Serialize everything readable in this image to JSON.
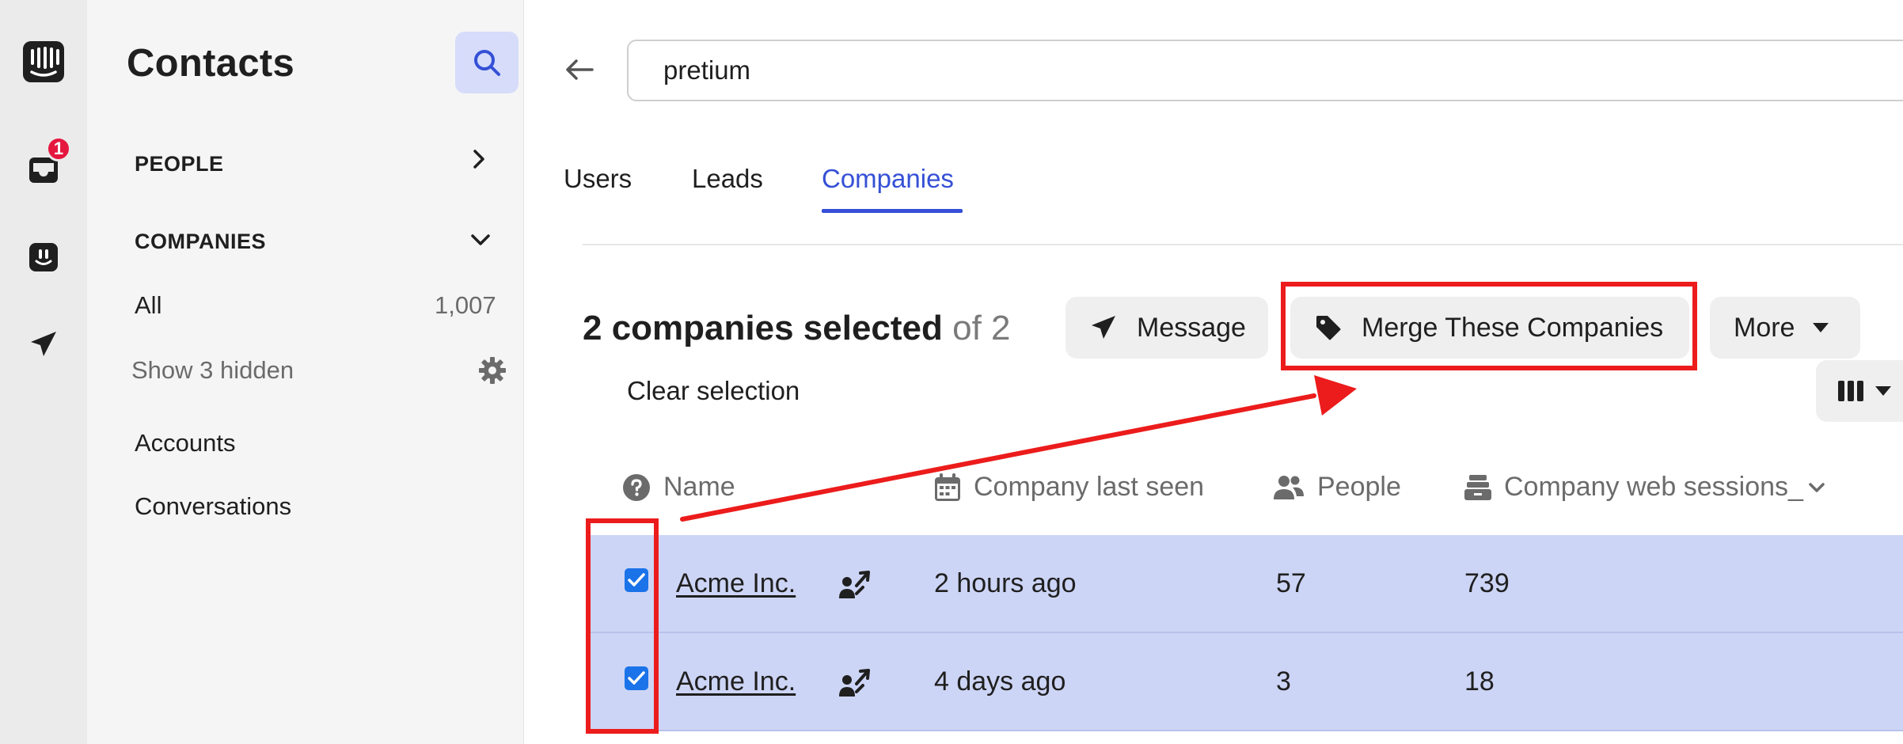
{
  "rail": {
    "inbox_badge": "1",
    "items": [
      "intercom-logo-icon",
      "inbox-icon",
      "operator-icon",
      "send-icon"
    ]
  },
  "sidebar": {
    "title": "Contacts",
    "sections": {
      "people": "PEOPLE",
      "companies": "COMPANIES"
    },
    "all_label": "All",
    "all_count": "1,007",
    "show_hidden": "Show 3 hidden",
    "accounts": "Accounts",
    "conversations": "Conversations"
  },
  "search": {
    "value": "pretium"
  },
  "tabs": [
    "Users",
    "Leads",
    "Companies"
  ],
  "active_tab": "Companies",
  "selection": {
    "count_label": "2 companies selected",
    "of_label": "of 2",
    "clear_label": "Clear selection"
  },
  "actions": {
    "message": "Message",
    "merge": "Merge These Companies",
    "more": "More"
  },
  "table": {
    "columns": [
      "Name",
      "Company last seen",
      "People",
      "Company web sessions_"
    ],
    "rows": [
      {
        "name": "Acme Inc.",
        "last_seen": "2 hours ago",
        "people": "57",
        "sessions": "739",
        "checked": true
      },
      {
        "name": "Acme Inc.",
        "last_seen": "4 days ago",
        "people": "3",
        "sessions": "18",
        "checked": true
      }
    ]
  },
  "colors": {
    "accent": "#3550d6",
    "selected_row": "#cdd5f6",
    "annotation": "#ec1c1c",
    "badge": "#e5173f"
  }
}
